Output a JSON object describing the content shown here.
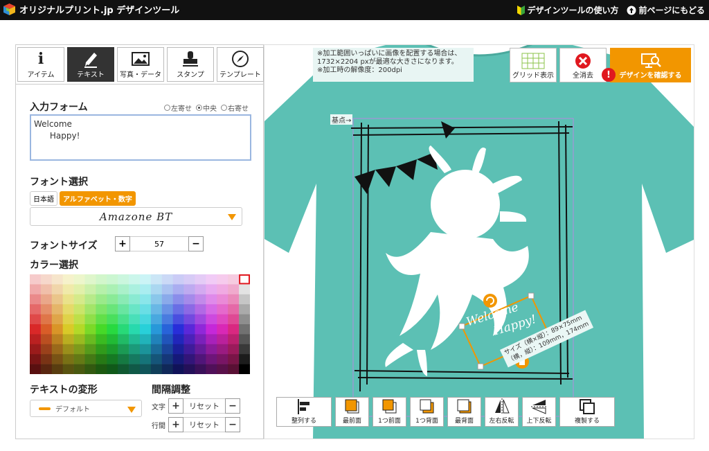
{
  "header": {
    "title": "オリジナルプリント.jp デザインツール",
    "nav": [
      {
        "label": "デザインツールの使い方",
        "icon": "beginner-icon"
      },
      {
        "label": "前ページにもどる",
        "icon": "back-icon"
      }
    ]
  },
  "panel": {
    "tabs": [
      {
        "label": "アイテム",
        "icon": "info-icon",
        "active": false
      },
      {
        "label": "テキスト",
        "icon": "pen-icon",
        "active": true
      },
      {
        "label": "写真・データ",
        "icon": "image-icon",
        "active": false
      },
      {
        "label": "スタンプ",
        "icon": "stamp-icon",
        "active": false
      },
      {
        "label": "テンプレート",
        "icon": "compass-icon",
        "active": false
      }
    ],
    "input_form": {
      "heading": "入力フォーム",
      "align": [
        "左寄せ",
        "中央",
        "右寄せ"
      ],
      "align_selected": "中央",
      "value": "Welcome\n      Happy!"
    },
    "font": {
      "heading": "フォント選択",
      "lang_ja": "日本語",
      "lang_alpha": "アルファベット・数字",
      "selected": "Amazone BT"
    },
    "font_size": {
      "heading": "フォントサイズ",
      "plus": "+",
      "minus": "−",
      "value": "57"
    },
    "color": {
      "heading": "カラー選択"
    },
    "transform": {
      "heading": "テキストの変形",
      "value": "デフォルト"
    },
    "spacing": {
      "heading": "間隔調整",
      "char_label": "文字",
      "line_label": "行間",
      "reset": "リセット",
      "plus": "+",
      "minus": "−"
    }
  },
  "stage": {
    "note_lines": [
      "※加工範囲いっぱいに画像を配置する場合は、",
      "1732×2204 pxが最適な大きさになります。",
      "※加工時の解像度：200dpi"
    ],
    "grid_label": "グリッド表示",
    "clear_label": "全消去",
    "confirm_label": "デザインを確認する",
    "warn_mark": "!",
    "origin_label": "基点→",
    "design_text_1": "Welcome",
    "design_text_2": "Happy!",
    "size_line1": "サイズ（横×縦）：89×75mm",
    "size_line2": "（横，縦）：109mm，174mm",
    "bottom_tools": [
      {
        "label": "整列する",
        "name": "align-button"
      },
      {
        "label": "最前面",
        "name": "bring-to-front-button"
      },
      {
        "label": "1つ前面",
        "name": "bring-forward-button"
      },
      {
        "label": "1つ背面",
        "name": "send-backward-button"
      },
      {
        "label": "最背面",
        "name": "send-to-back-button"
      },
      {
        "label": "左右反転",
        "name": "flip-horizontal-button"
      },
      {
        "label": "上下反転",
        "name": "flip-vertical-button"
      },
      {
        "label": "複製する",
        "name": "duplicate-button"
      }
    ],
    "colors": {
      "tshirt": "#5cc0b4",
      "accent": "#f29600",
      "warn": "#e0181f"
    }
  }
}
